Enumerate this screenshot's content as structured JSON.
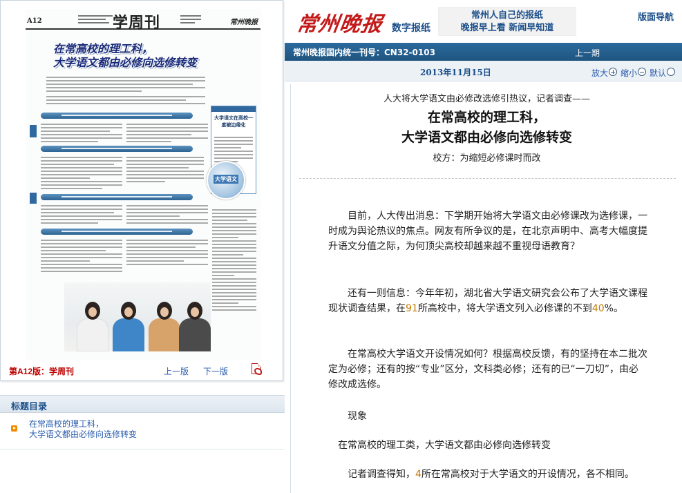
{
  "left": {
    "page_thumb": {
      "page_number": "A12",
      "section": "学周刊",
      "brand": "常州晚报",
      "headline_lines": [
        "在常高校的理工科，",
        "大学语文都由必修向选修转变"
      ],
      "sidebox_text": "大学语文在高校一度被边缘化",
      "book_label": "大学语文"
    },
    "caption": "第A12版：学周刊",
    "prev_page": "上一版",
    "next_page": "下一版",
    "pdf_icon": "pdf-icon",
    "toc": {
      "title": "标题目录",
      "items": [
        {
          "line1": "在常高校的理工科，",
          "line2": "大学语文都由必修向选修转变"
        }
      ]
    }
  },
  "header": {
    "brand": "常州晚报",
    "product": "数字报纸",
    "slogan": [
      "常州人自己的报纸",
      "晚报早上看 新闻早知道"
    ],
    "nav": "版面导航",
    "issn": "常州晚报国内统一刊号：CN32-0103",
    "prev_issue": "上一期",
    "date": "2013年11月15日",
    "zoom_in": "放大",
    "zoom_out": "缩小",
    "zoom_default": "默认"
  },
  "article": {
    "kicker": "人大将大学语文由必修改选修引热议，记者调查——",
    "headline": [
      "在常高校的理工科，",
      "大学语文都由必修向选修转变"
    ],
    "subhead": "校方：为缩短必修课时而改",
    "p1": "目前，人大传出消息：下学期开始将大学语文由必修课改为选修课，一时成为舆论热议的焦点。网友有所争议的是，在北京声明中、高考大幅度提升语文分值之际，为何顶尖高校却越来越不重视母语教育？",
    "p2": {
      "a": "还有一则信息：今年年初，湖北省大学语文研究会公布了大学语文课程现状调查结果，在",
      "n1": "91",
      "b": "所高校中，将大学语文列入必修课的不到",
      "n2": "40",
      "c": "%。"
    },
    "p3": "在常高校大学语文开设情况如何？根据高校反馈，有的坚持在本二批次定为必修；还有的按“专业”区分，文科类必修；还有的已“一刀切”，由必修改成选修。",
    "p4": "现象",
    "p5": "在常高校的理工类，大学语文都由必修向选修转变",
    "p6": {
      "a": "记者调查得知，",
      "n1": "4",
      "b": "所在常高校对于大学语文的开设情况，各不相同。"
    }
  },
  "colors": {
    "brand_red": "#c41a1a",
    "nav_blue": "#1f557f",
    "link_blue": "#2a5cad",
    "number_orange": "#c27b00"
  }
}
